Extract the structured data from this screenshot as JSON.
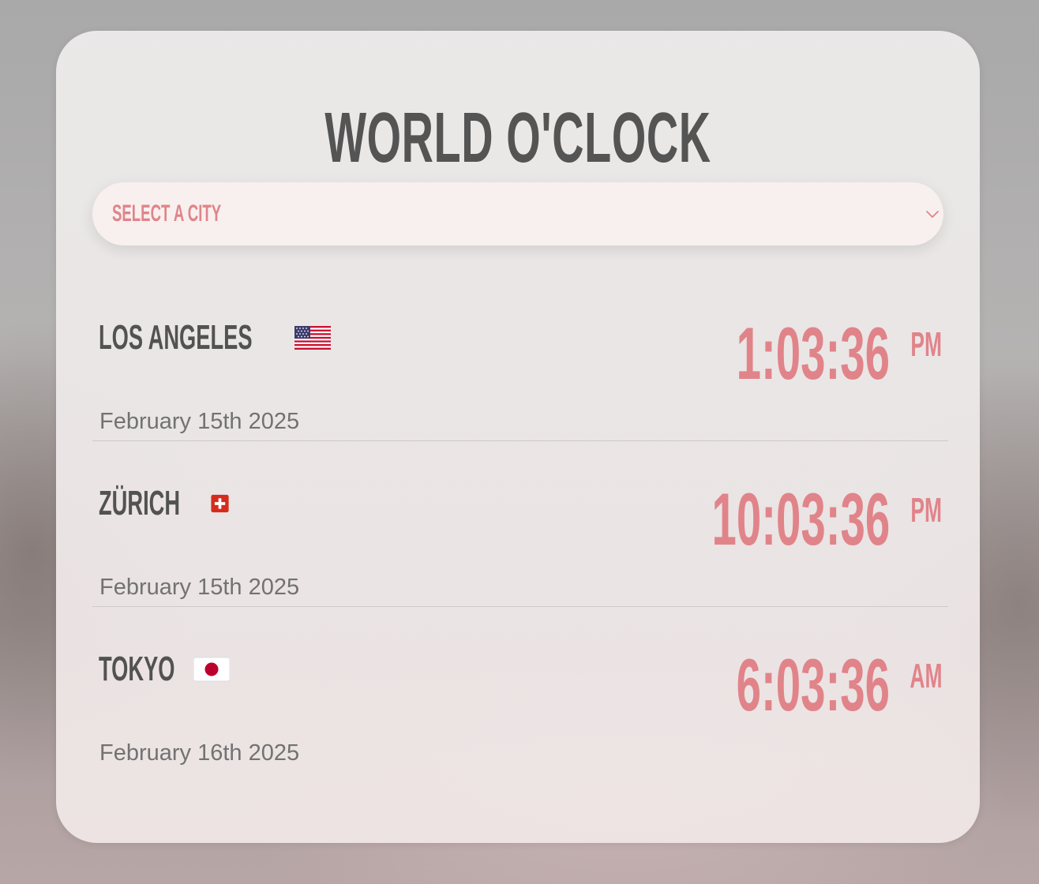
{
  "app": {
    "title": "WORLD O'CLOCK"
  },
  "select": {
    "label": "SELECT A CITY",
    "icon": "chevron-down-icon"
  },
  "colors": {
    "accent": "#e0848a",
    "heading": "#545454",
    "date": "#727272",
    "select_bg": "#f8f0ef"
  },
  "cities": [
    {
      "name": "LOS ANGELES",
      "flag": "us-flag-icon",
      "date": "February 15th 2025",
      "time": "1:03:36",
      "ampm": "PM"
    },
    {
      "name": "ZÜRICH",
      "flag": "switzerland-flag-icon",
      "date": "February 15th 2025",
      "time": "10:03:36",
      "ampm": "PM"
    },
    {
      "name": "TOKYO",
      "flag": "japan-flag-icon",
      "date": "February 16th 2025",
      "time": "6:03:36",
      "ampm": "AM"
    }
  ]
}
